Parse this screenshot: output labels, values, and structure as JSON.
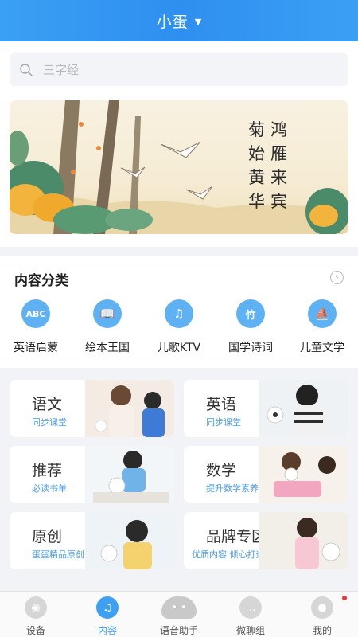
{
  "header": {
    "title": "小蛋",
    "dropdown_icon": "caret-down-icon"
  },
  "search": {
    "placeholder": "三字经",
    "icon": "search-icon"
  },
  "banner": {
    "poem_right": [
      "鸿",
      "雁",
      "来",
      "宾"
    ],
    "poem_left": [
      "菊",
      "始",
      "黄",
      "华"
    ]
  },
  "category": {
    "title": "内容分类",
    "more_icon": "chevron-right-icon",
    "items": [
      {
        "label": "英语启蒙",
        "icon": "abc-icon",
        "glyph": "ABC"
      },
      {
        "label": "绘本王国",
        "icon": "book-icon",
        "glyph": "📖"
      },
      {
        "label": "儿歌KTV",
        "icon": "music-note-icon",
        "glyph": "♫"
      },
      {
        "label": "国学诗词",
        "icon": "bamboo-icon",
        "glyph": "竹"
      },
      {
        "label": "儿童文学",
        "icon": "ship-icon",
        "glyph": "⛵"
      }
    ]
  },
  "cards": [
    {
      "title": "语文",
      "subtitle": "同步课堂"
    },
    {
      "title": "英语",
      "subtitle": "同步课堂"
    },
    {
      "title": "推荐",
      "subtitle": "必读书单"
    },
    {
      "title": "数学",
      "subtitle": "提升数学素养"
    },
    {
      "title": "原创",
      "subtitle": "蛋蛋精品原创"
    },
    {
      "title": "品牌专区",
      "subtitle": "优质内容 倾心打造"
    }
  ],
  "nav": {
    "items": [
      {
        "label": "设备",
        "icon": "device-icon",
        "active": false
      },
      {
        "label": "内容",
        "icon": "music-icon",
        "active": true
      },
      {
        "label": "语音助手",
        "icon": "robot-icon",
        "active": false
      },
      {
        "label": "微聊组",
        "icon": "chat-icon",
        "active": false
      },
      {
        "label": "我的",
        "icon": "profile-icon",
        "active": false
      }
    ]
  },
  "colors": {
    "primary": "#3ea0f2",
    "category_icon": "#5eb1f2",
    "subtitle": "#4a9ce8",
    "background_gray": "#f2f3f6"
  }
}
